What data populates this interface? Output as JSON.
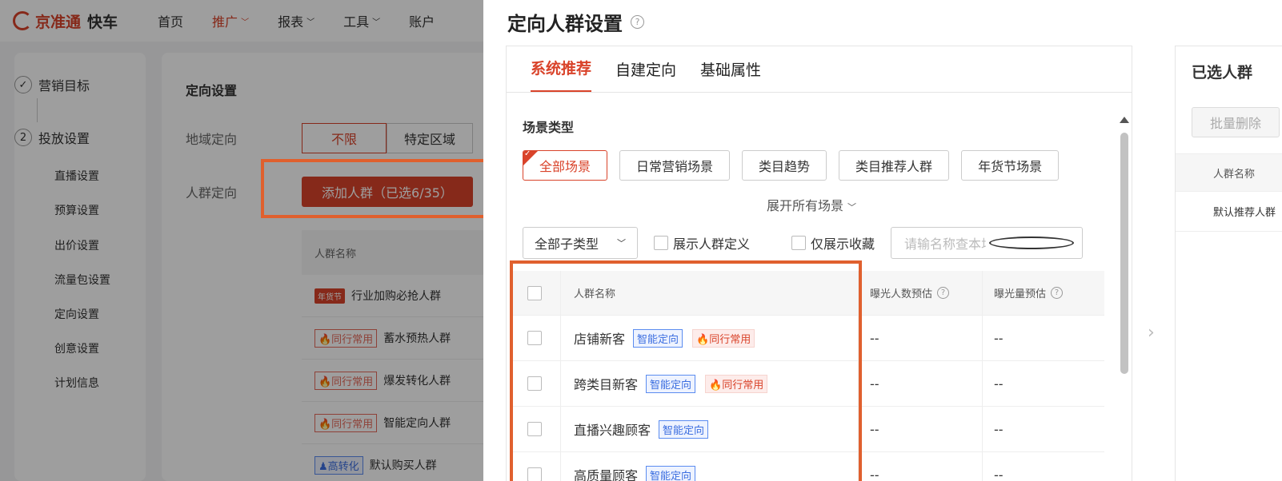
{
  "app": {
    "logo_text": "京准通",
    "logo_sub": "快车",
    "nav": [
      {
        "label": "首页"
      },
      {
        "label": "推广"
      },
      {
        "label": "报表"
      },
      {
        "label": "工具"
      },
      {
        "label": "账户"
      }
    ],
    "steps": [
      {
        "num": "✓",
        "label": "营销目标"
      },
      {
        "num": "2",
        "label": "投放设置"
      }
    ],
    "sub_items": [
      "直播设置",
      "预算设置",
      "出价设置",
      "流量包设置",
      "定向设置",
      "创意设置",
      "计划信息"
    ],
    "section_title": "定向设置",
    "region_label": "地域定向",
    "region_options": [
      "不限",
      "特定区域"
    ],
    "audience_label": "人群定向",
    "add_button": "添加人群（已选6/35）",
    "table_header": "人群名称",
    "rows": [
      {
        "tag": "",
        "name": "行业加购必抢人群"
      },
      {
        "tag": "🔥同行常用",
        "name": "蓄水预热人群"
      },
      {
        "tag": "🔥同行常用",
        "name": "爆发转化人群"
      },
      {
        "tag": "🔥同行常用",
        "name": "智能定向人群"
      },
      {
        "tag": "♟高转化",
        "name": "默认购买人群"
      }
    ]
  },
  "drawer": {
    "title": "定向人群设置",
    "tabs": [
      "系统推荐",
      "自建定向",
      "基础属性"
    ],
    "scene_label": "场景类型",
    "scenes": [
      "全部场景",
      "日常营销场景",
      "类目趋势",
      "类目推荐人群",
      "年货节场景"
    ],
    "expand": "展开所有场景",
    "subtype_select": "全部子类型",
    "show_definition": "展示人群定义",
    "show_favorites": "仅展示收藏",
    "search_placeholder": "请输名称查本场景下人群",
    "columns": {
      "name": "人群名称",
      "exp_people": "曝光人数预估",
      "exp_count": "曝光量预估"
    },
    "rows": [
      {
        "name": "店铺新客",
        "tags": [
          "智能定向"
        ],
        "fire": "同行常用",
        "exp_people": "--",
        "exp_count": "--"
      },
      {
        "name": "跨类目新客",
        "tags": [
          "智能定向"
        ],
        "fire": "同行常用",
        "exp_people": "--",
        "exp_count": "--"
      },
      {
        "name": "直播兴趣顾客",
        "tags": [
          "智能定向"
        ],
        "fire": "",
        "exp_people": "--",
        "exp_count": "--"
      },
      {
        "name": "高质量顾客",
        "tags": [
          "智能定向"
        ],
        "fire": "",
        "exp_people": "--",
        "exp_count": "--"
      }
    ],
    "selected": {
      "title": "已选人群",
      "batch_delete": "批量删除",
      "col_name": "人群名称",
      "rows": [
        "默认推荐人群"
      ]
    }
  },
  "colors": {
    "accent": "#d9432a",
    "highlight": "#e0602e",
    "tag_blue": "#3d6fe0"
  }
}
